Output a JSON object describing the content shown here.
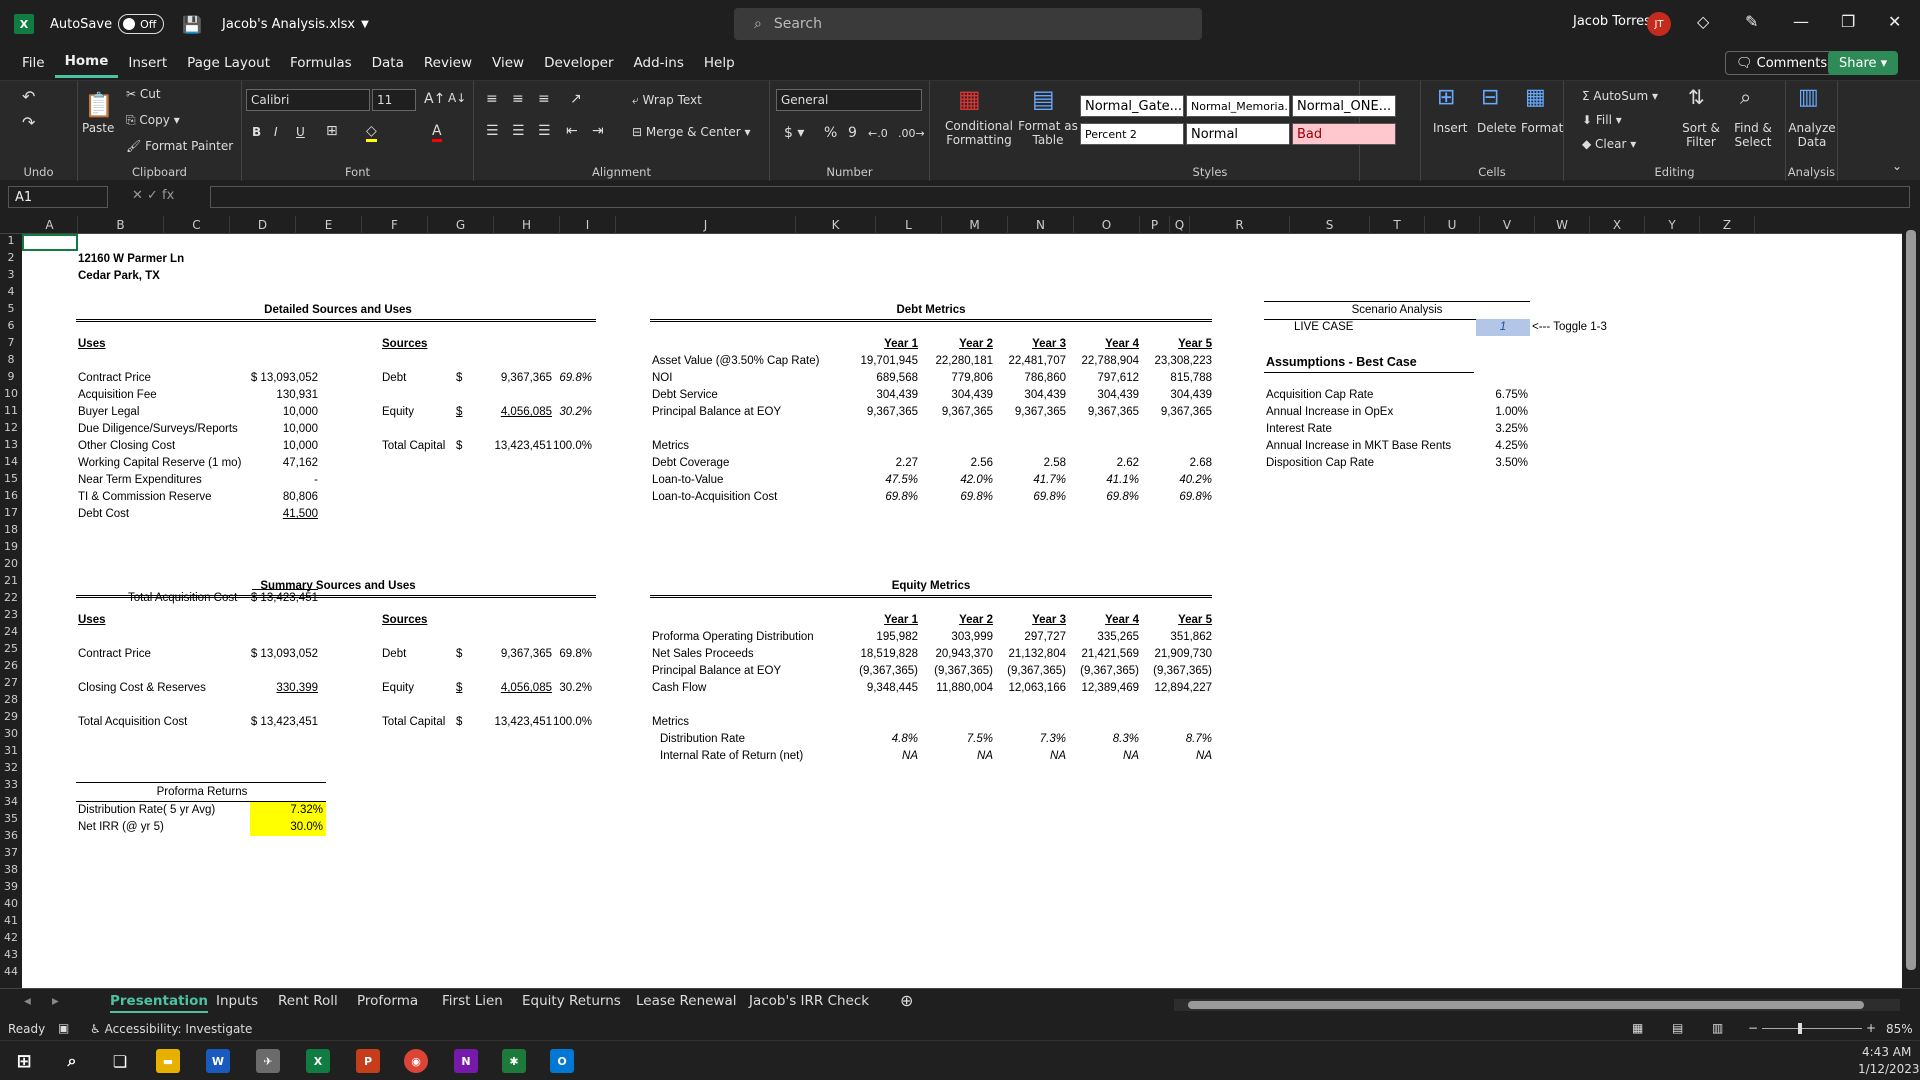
{
  "window": {
    "autosave": "AutoSave",
    "autosave_state": "Off",
    "filename": "Jacob's Analysis.xlsx",
    "search_placeholder": "Search",
    "user": "Jacob Torres",
    "user_initials": "JT"
  },
  "menu": [
    "File",
    "Home",
    "Insert",
    "Page Layout",
    "Formulas",
    "Data",
    "Review",
    "View",
    "Developer",
    "Add-ins",
    "Help"
  ],
  "actions": {
    "comments": "Comments",
    "share": "Share"
  },
  "ribbon": {
    "undo_label": "Undo",
    "clipboard": {
      "label": "Clipboard",
      "paste": "Paste",
      "cut": "Cut",
      "copy": "Copy",
      "format_painter": "Format Painter"
    },
    "font": {
      "label": "Font",
      "name": "Calibri",
      "size": "11"
    },
    "alignment": {
      "label": "Alignment",
      "wrap": "Wrap Text",
      "merge": "Merge & Center"
    },
    "number": {
      "label": "Number",
      "format": "General"
    },
    "styles": {
      "label": "Styles",
      "conditional": "Conditional Formatting",
      "format_table": "Format as Table",
      "items": [
        "Normal_Gate...",
        "Normal_Memoria...",
        "Normal_ONE...",
        "Percent 2",
        "Normal",
        "Bad"
      ]
    },
    "cells": {
      "label": "Cells",
      "insert": "Insert",
      "delete": "Delete",
      "format": "Format"
    },
    "editing": {
      "label": "Editing",
      "autosum": "AutoSum",
      "fill": "Fill",
      "clear": "Clear",
      "sort": "Sort & Filter",
      "find": "Find & Select"
    },
    "analysis": {
      "label": "Analysis",
      "analyze": "Analyze Data"
    }
  },
  "namebox": "A1",
  "columns": [
    "A",
    "B",
    "C",
    "D",
    "E",
    "F",
    "G",
    "H",
    "I",
    "J",
    "K",
    "L",
    "M",
    "N",
    "O",
    "P",
    "Q",
    "R",
    "S",
    "T",
    "U",
    "V",
    "W",
    "X",
    "Y",
    "Z"
  ],
  "address": {
    "line1": "12160 W Parmer Ln",
    "line2": "Cedar Park, TX"
  },
  "detailed": {
    "title": "Detailed Sources and Uses",
    "uses_hdr": "Uses",
    "sources_hdr": "Sources",
    "uses": [
      [
        "Contract Price",
        "$ 13,093,052"
      ],
      [
        "Acquisition Fee",
        "130,931"
      ],
      [
        "Buyer Legal",
        "10,000"
      ],
      [
        "Due Diligence/Surveys/Reports",
        "10,000"
      ],
      [
        "Other Closing Cost",
        "10,000"
      ],
      [
        "Working Capital Reserve (1 mo)",
        "47,162"
      ],
      [
        "Near Term Expenditures",
        "-"
      ],
      [
        "TI & Commission Reserve",
        "80,806"
      ],
      [
        "Debt Cost",
        "41,500"
      ]
    ],
    "total_label": "Total Acquisition Cost",
    "total": "$ 13,423,451",
    "debt": [
      "Debt",
      "$",
      "9,367,365",
      "69.8%"
    ],
    "equity": [
      "Equity",
      "$",
      "4,056,085",
      "30.2%"
    ],
    "capital": [
      "Total Capital",
      "$",
      "13,423,451",
      "100.0%"
    ]
  },
  "summary": {
    "title": "Summary Sources and Uses",
    "uses_hdr": "Uses",
    "sources_hdr": "Sources",
    "contract": [
      "Contract Price",
      "$ 13,093,052"
    ],
    "closing": [
      "Closing Cost & Reserves",
      "330,399"
    ],
    "total": [
      "Total Acquisition Cost",
      "$ 13,423,451"
    ],
    "debt": [
      "Debt",
      "$",
      "9,367,365",
      "69.8%"
    ],
    "equity": [
      "Equity",
      "$",
      "4,056,085",
      "30.2%"
    ],
    "capital": [
      "Total Capital",
      "$",
      "13,423,451",
      "100.0%"
    ]
  },
  "proforma": {
    "title": "Proforma Returns",
    "rows": [
      [
        "Distribution Rate( 5 yr Avg)",
        "7.32%"
      ],
      [
        "Net IRR (@ yr 5)",
        "30.0%"
      ]
    ]
  },
  "debt_metrics": {
    "title": "Debt Metrics",
    "years": [
      "Year 1",
      "Year 2",
      "Year 3",
      "Year 4",
      "Year 5"
    ],
    "rows": [
      [
        "Asset Value (@3.50% Cap Rate)",
        "19,701,945",
        "22,280,181",
        "22,481,707",
        "22,788,904",
        "23,308,223"
      ],
      [
        "NOI",
        "689,568",
        "779,806",
        "786,860",
        "797,612",
        "815,788"
      ],
      [
        "Debt Service",
        "304,439",
        "304,439",
        "304,439",
        "304,439",
        "304,439"
      ],
      [
        "Principal Balance at EOY",
        "9,367,365",
        "9,367,365",
        "9,367,365",
        "9,367,365",
        "9,367,365"
      ]
    ],
    "metrics_label": "Metrics",
    "metrics": [
      [
        "Debt Coverage",
        "2.27",
        "2.56",
        "2.58",
        "2.62",
        "2.68"
      ],
      [
        "Loan-to-Value",
        "47.5%",
        "42.0%",
        "41.7%",
        "41.1%",
        "40.2%"
      ],
      [
        "Loan-to-Acquisition Cost",
        "69.8%",
        "69.8%",
        "69.8%",
        "69.8%",
        "69.8%"
      ]
    ]
  },
  "equity_metrics": {
    "title": "Equity Metrics",
    "years": [
      "Year 1",
      "Year 2",
      "Year 3",
      "Year 4",
      "Year 5"
    ],
    "rows": [
      [
        "Proforma Operating Distribution",
        "195,982",
        "303,999",
        "297,727",
        "335,265",
        "351,862"
      ],
      [
        "Net Sales Proceeds",
        "18,519,828",
        "20,943,370",
        "21,132,804",
        "21,421,569",
        "21,909,730"
      ],
      [
        "Principal Balance at EOY",
        "(9,367,365)",
        "(9,367,365)",
        "(9,367,365)",
        "(9,367,365)",
        "(9,367,365)"
      ],
      [
        "Cash Flow",
        "9,348,445",
        "11,880,004",
        "12,063,166",
        "12,389,469",
        "12,894,227"
      ]
    ],
    "metrics_label": "Metrics",
    "metrics": [
      [
        "Distribution Rate",
        "4.8%",
        "7.5%",
        "7.3%",
        "8.3%",
        "8.7%"
      ],
      [
        "Internal Rate of Return (net)",
        "NA",
        "NA",
        "NA",
        "NA",
        "NA"
      ]
    ]
  },
  "scenario": {
    "title": "Scenario Analysis",
    "live": "LIVE CASE",
    "value": "1",
    "toggle": "<--- Toggle 1-3",
    "assump_title": "Assumptions  - Best Case",
    "rows": [
      [
        "Acquisition Cap Rate",
        "6.75%"
      ],
      [
        "Annual Increase in OpEx",
        "1.00%"
      ],
      [
        "Interest Rate",
        "3.25%"
      ],
      [
        "Annual Increase in MKT Base Rents",
        "4.25%"
      ],
      [
        "Disposition Cap Rate",
        "3.50%"
      ]
    ]
  },
  "tabs": [
    "Presentation",
    "Inputs",
    "Rent Roll",
    "Proforma",
    "First Lien",
    "Equity Returns",
    "Lease Renewal",
    "Jacob's IRR Check"
  ],
  "status": {
    "ready": "Ready",
    "accessibility": "Accessibility: Investigate",
    "zoom": "85%"
  },
  "clock": {
    "time": "4:43 AM",
    "date": "1/12/2023"
  }
}
